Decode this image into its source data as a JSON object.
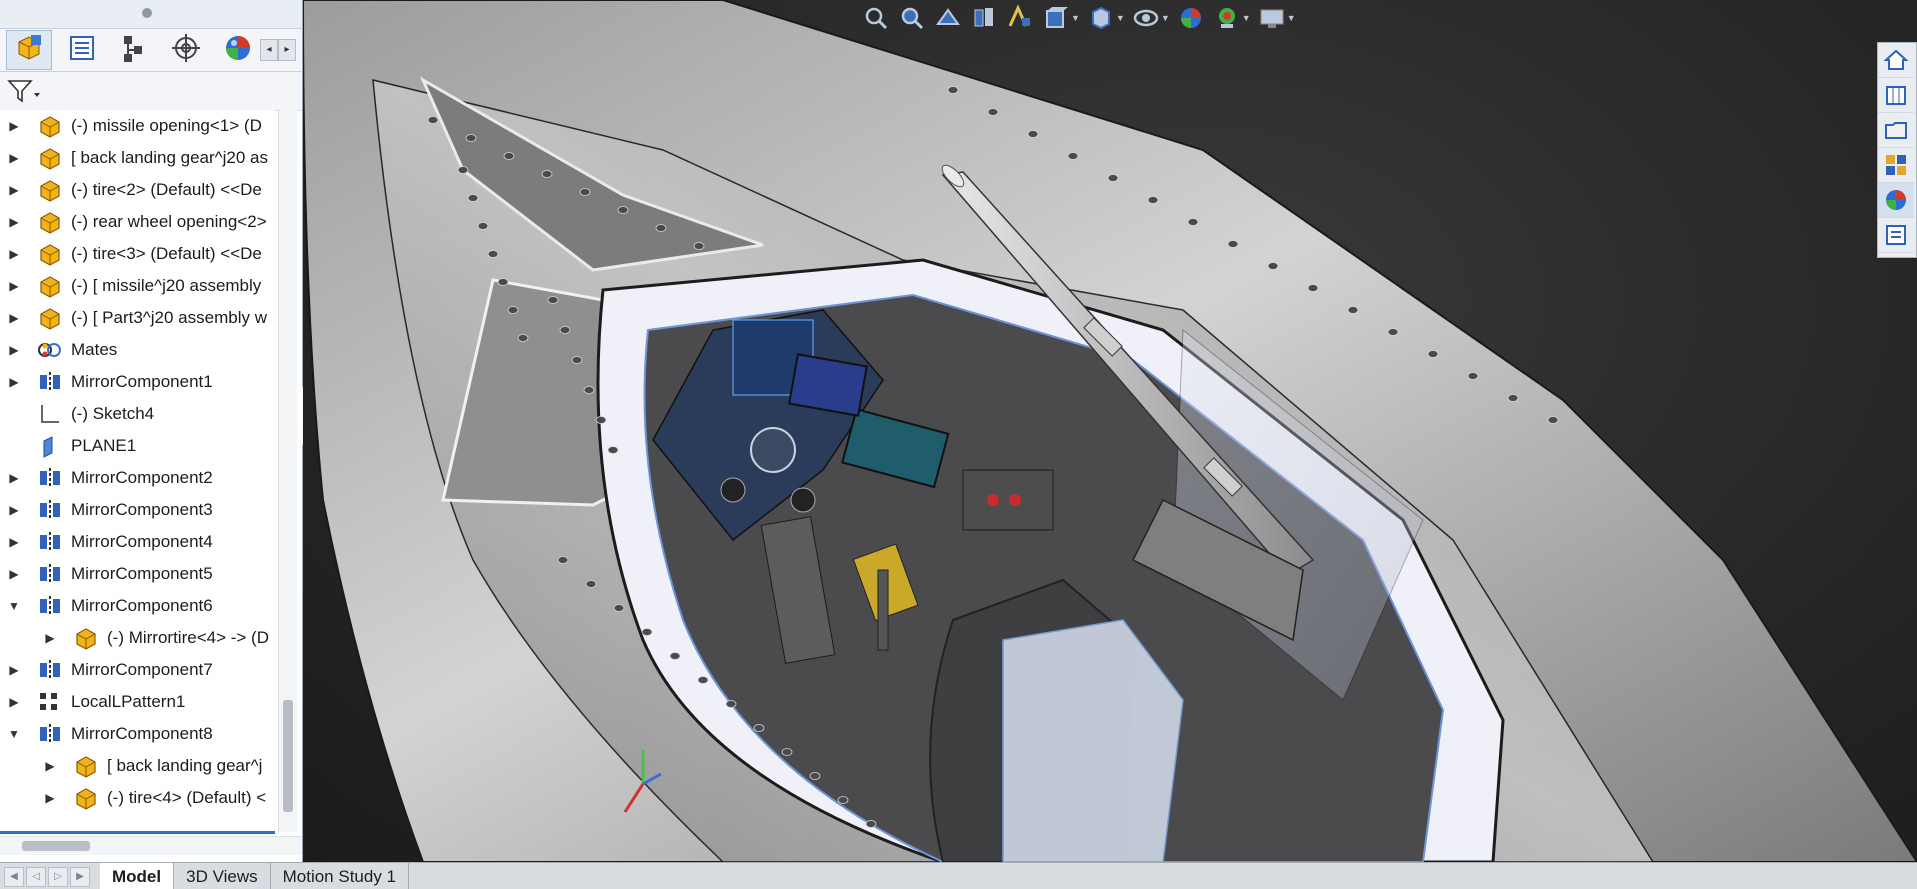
{
  "feature_manager": {
    "tabs": [
      {
        "name": "featuremanager-tab",
        "icon": "assembly-icon",
        "active": true
      },
      {
        "name": "propertymanager-tab",
        "icon": "property-list-icon",
        "active": false
      },
      {
        "name": "configurationmanager-tab",
        "icon": "configuration-tree-icon",
        "active": false
      },
      {
        "name": "dimxpert-tab",
        "icon": "crosshair-target-icon",
        "active": false
      },
      {
        "name": "display-manager-tab",
        "icon": "appearance-sphere-icon",
        "active": false
      }
    ],
    "filter_icon": "filter-funnel-icon",
    "tree": [
      {
        "label": "(-) missile opening<1> (D",
        "icon": "part-icon",
        "expanded": false,
        "indent": 0
      },
      {
        "label": "[ back landing gear^j20 as",
        "icon": "part-icon",
        "expanded": false,
        "indent": 0
      },
      {
        "label": "(-) tire<2> (Default) <<De",
        "icon": "part-icon",
        "expanded": false,
        "indent": 0
      },
      {
        "label": "(-) rear wheel opening<2>",
        "icon": "part-icon",
        "expanded": false,
        "indent": 0
      },
      {
        "label": "(-) tire<3> (Default) <<De",
        "icon": "part-icon",
        "expanded": false,
        "indent": 0
      },
      {
        "label": "(-) [ missile^j20 assembly",
        "icon": "part-icon",
        "expanded": false,
        "indent": 0
      },
      {
        "label": "(-) [ Part3^j20 assembly w",
        "icon": "part-icon",
        "expanded": false,
        "indent": 0
      },
      {
        "label": "Mates",
        "icon": "mates-icon",
        "expanded": false,
        "indent": 0
      },
      {
        "label": "MirrorComponent1",
        "icon": "mirror-component-icon",
        "expanded": false,
        "indent": 0
      },
      {
        "label": "(-) Sketch4",
        "icon": "sketch-icon",
        "expanded": null,
        "indent": 0
      },
      {
        "label": "PLANE1",
        "icon": "plane-icon",
        "expanded": null,
        "indent": 0
      },
      {
        "label": "MirrorComponent2",
        "icon": "mirror-component-icon",
        "expanded": false,
        "indent": 0
      },
      {
        "label": "MirrorComponent3",
        "icon": "mirror-component-icon",
        "expanded": false,
        "indent": 0
      },
      {
        "label": "MirrorComponent4",
        "icon": "mirror-component-icon",
        "expanded": false,
        "indent": 0
      },
      {
        "label": "MirrorComponent5",
        "icon": "mirror-component-icon",
        "expanded": false,
        "indent": 0
      },
      {
        "label": "MirrorComponent6",
        "icon": "mirror-component-icon",
        "expanded": true,
        "indent": 0
      },
      {
        "label": "(-) Mirrortire<4> -> (D",
        "icon": "part-icon",
        "expanded": false,
        "indent": 1
      },
      {
        "label": "MirrorComponent7",
        "icon": "mirror-component-icon",
        "expanded": false,
        "indent": 0
      },
      {
        "label": "LocalLPattern1",
        "icon": "linear-pattern-icon",
        "expanded": false,
        "indent": 0
      },
      {
        "label": "MirrorComponent8",
        "icon": "mirror-component-icon",
        "expanded": true,
        "indent": 0
      },
      {
        "label": "[ back landing gear^j",
        "icon": "part-icon",
        "expanded": false,
        "indent": 1
      },
      {
        "label": "(-) tire<4> (Default) <",
        "icon": "part-icon",
        "expanded": false,
        "indent": 1
      }
    ]
  },
  "heads_up_toolbar": [
    {
      "icon": "zoom-to-fit-icon",
      "caret": false
    },
    {
      "icon": "zoom-to-area-icon",
      "caret": false
    },
    {
      "icon": "previous-view-icon",
      "caret": false
    },
    {
      "icon": "section-view-icon",
      "caret": false
    },
    {
      "icon": "dynamic-annotation-icon",
      "caret": false
    },
    {
      "icon": "view-orientation-icon",
      "caret": true
    },
    {
      "icon": "display-style-icon",
      "caret": true
    },
    {
      "icon": "hide-show-items-icon",
      "caret": true
    },
    {
      "icon": "edit-appearance-icon",
      "caret": false
    },
    {
      "icon": "apply-scene-icon",
      "caret": true
    },
    {
      "icon": "view-settings-icon",
      "caret": true
    }
  ],
  "task_pane": [
    {
      "icon": "home-icon",
      "active": false
    },
    {
      "icon": "design-library-icon",
      "active": false
    },
    {
      "icon": "file-explorer-icon",
      "active": false
    },
    {
      "icon": "view-palette-icon",
      "active": false
    },
    {
      "icon": "appearances-icon",
      "active": true
    },
    {
      "icon": "custom-properties-icon",
      "active": false
    }
  ],
  "bottom_tabs": [
    {
      "label": "Model",
      "active": true
    },
    {
      "label": "3D Views",
      "active": false
    },
    {
      "label": "Motion Study 1",
      "active": false
    }
  ],
  "triad_axes": [
    "x-axis",
    "y-axis",
    "z-axis"
  ],
  "colors": {
    "viewport_bg": "#262626",
    "accent": "#2f6fc6",
    "part_icon": "#f2b418",
    "fuselage": "#b8b8b8"
  }
}
